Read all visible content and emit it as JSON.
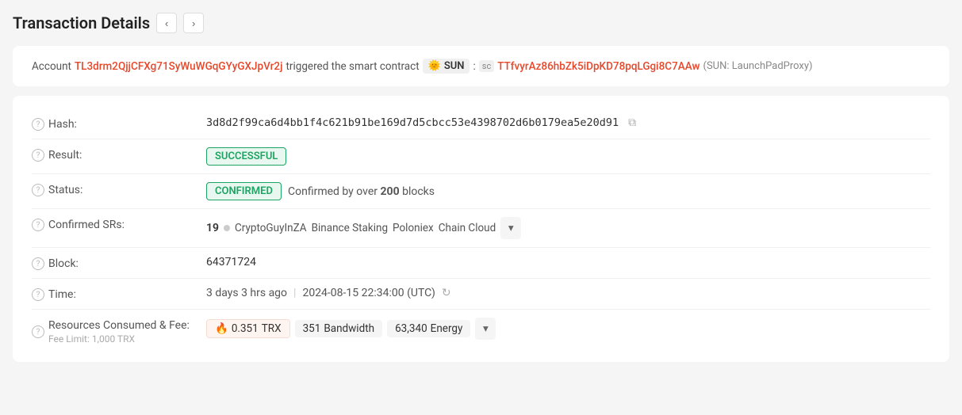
{
  "page": {
    "title": "Transaction Details",
    "nav": {
      "prev_label": "‹",
      "next_label": "›"
    }
  },
  "account_line": {
    "prefix": "Account",
    "account_address": "TL3drm2QjjCFXg71SyWuWGqGYyGXJpVr2j",
    "middle_text": "triggered the smart contract",
    "token_emoji": "🌞",
    "token_name": "SUN",
    "separator": ":",
    "sc_label": "sc",
    "contract_address": "TTfvyrAz86hbZk5iDpKD78pqLGgi8C7AAw",
    "contract_note": "(SUN: LaunchPadProxy)"
  },
  "details": {
    "hash": {
      "label": "Hash:",
      "value": "3d8d2f99ca6d4bb1f4c621b91be169d7d5cbcc53e4398702d6b0179ea5e20d91",
      "copy_title": "Copy"
    },
    "result": {
      "label": "Result:",
      "value": "SUCCESSFUL"
    },
    "status": {
      "label": "Status:",
      "badge": "CONFIRMED",
      "description": "Confirmed by over",
      "blocks_count": "200",
      "blocks_label": "blocks"
    },
    "confirmed_srs": {
      "label": "Confirmed SRs:",
      "count": "19",
      "items": [
        "CryptoGuyInZA",
        "Binance Staking",
        "Poloniex",
        "Chain Cloud"
      ],
      "more_label": "▾"
    },
    "block": {
      "label": "Block:",
      "value": "64371724"
    },
    "time": {
      "label": "Time:",
      "relative": "3 days 3 hrs ago",
      "separator": "|",
      "utc": "2024-08-15 22:34:00 (UTC)"
    },
    "resources": {
      "label": "Resources Consumed & Fee:",
      "fee_limit_label": "Fee Limit: 1,000 TRX",
      "trx_amount": "0.351",
      "trx_unit": "TRX",
      "bandwidth_amount": "351",
      "bandwidth_label": "Bandwidth",
      "energy_amount": "63,340",
      "energy_label": "Energy"
    }
  },
  "colors": {
    "red_link": "#e8472a",
    "green_badge": "#1da462",
    "green_bg": "#e8f8f0"
  }
}
